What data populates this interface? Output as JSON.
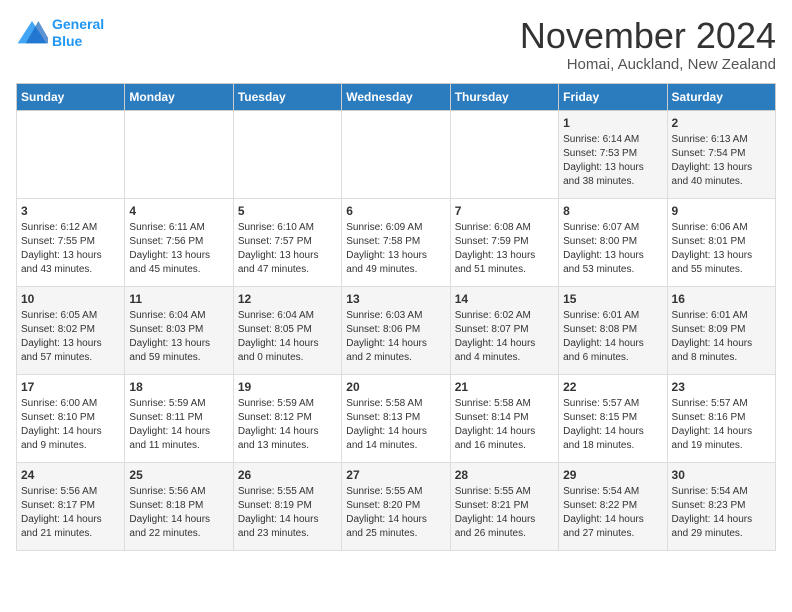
{
  "logo": {
    "line1": "General",
    "line2": "Blue"
  },
  "title": "November 2024",
  "subtitle": "Homai, Auckland, New Zealand",
  "days_of_week": [
    "Sunday",
    "Monday",
    "Tuesday",
    "Wednesday",
    "Thursday",
    "Friday",
    "Saturday"
  ],
  "weeks": [
    [
      {
        "day": "",
        "content": ""
      },
      {
        "day": "",
        "content": ""
      },
      {
        "day": "",
        "content": ""
      },
      {
        "day": "",
        "content": ""
      },
      {
        "day": "",
        "content": ""
      },
      {
        "day": "1",
        "content": "Sunrise: 6:14 AM\nSunset: 7:53 PM\nDaylight: 13 hours\nand 38 minutes."
      },
      {
        "day": "2",
        "content": "Sunrise: 6:13 AM\nSunset: 7:54 PM\nDaylight: 13 hours\nand 40 minutes."
      }
    ],
    [
      {
        "day": "3",
        "content": "Sunrise: 6:12 AM\nSunset: 7:55 PM\nDaylight: 13 hours\nand 43 minutes."
      },
      {
        "day": "4",
        "content": "Sunrise: 6:11 AM\nSunset: 7:56 PM\nDaylight: 13 hours\nand 45 minutes."
      },
      {
        "day": "5",
        "content": "Sunrise: 6:10 AM\nSunset: 7:57 PM\nDaylight: 13 hours\nand 47 minutes."
      },
      {
        "day": "6",
        "content": "Sunrise: 6:09 AM\nSunset: 7:58 PM\nDaylight: 13 hours\nand 49 minutes."
      },
      {
        "day": "7",
        "content": "Sunrise: 6:08 AM\nSunset: 7:59 PM\nDaylight: 13 hours\nand 51 minutes."
      },
      {
        "day": "8",
        "content": "Sunrise: 6:07 AM\nSunset: 8:00 PM\nDaylight: 13 hours\nand 53 minutes."
      },
      {
        "day": "9",
        "content": "Sunrise: 6:06 AM\nSunset: 8:01 PM\nDaylight: 13 hours\nand 55 minutes."
      }
    ],
    [
      {
        "day": "10",
        "content": "Sunrise: 6:05 AM\nSunset: 8:02 PM\nDaylight: 13 hours\nand 57 minutes."
      },
      {
        "day": "11",
        "content": "Sunrise: 6:04 AM\nSunset: 8:03 PM\nDaylight: 13 hours\nand 59 minutes."
      },
      {
        "day": "12",
        "content": "Sunrise: 6:04 AM\nSunset: 8:05 PM\nDaylight: 14 hours\nand 0 minutes."
      },
      {
        "day": "13",
        "content": "Sunrise: 6:03 AM\nSunset: 8:06 PM\nDaylight: 14 hours\nand 2 minutes."
      },
      {
        "day": "14",
        "content": "Sunrise: 6:02 AM\nSunset: 8:07 PM\nDaylight: 14 hours\nand 4 minutes."
      },
      {
        "day": "15",
        "content": "Sunrise: 6:01 AM\nSunset: 8:08 PM\nDaylight: 14 hours\nand 6 minutes."
      },
      {
        "day": "16",
        "content": "Sunrise: 6:01 AM\nSunset: 8:09 PM\nDaylight: 14 hours\nand 8 minutes."
      }
    ],
    [
      {
        "day": "17",
        "content": "Sunrise: 6:00 AM\nSunset: 8:10 PM\nDaylight: 14 hours\nand 9 minutes."
      },
      {
        "day": "18",
        "content": "Sunrise: 5:59 AM\nSunset: 8:11 PM\nDaylight: 14 hours\nand 11 minutes."
      },
      {
        "day": "19",
        "content": "Sunrise: 5:59 AM\nSunset: 8:12 PM\nDaylight: 14 hours\nand 13 minutes."
      },
      {
        "day": "20",
        "content": "Sunrise: 5:58 AM\nSunset: 8:13 PM\nDaylight: 14 hours\nand 14 minutes."
      },
      {
        "day": "21",
        "content": "Sunrise: 5:58 AM\nSunset: 8:14 PM\nDaylight: 14 hours\nand 16 minutes."
      },
      {
        "day": "22",
        "content": "Sunrise: 5:57 AM\nSunset: 8:15 PM\nDaylight: 14 hours\nand 18 minutes."
      },
      {
        "day": "23",
        "content": "Sunrise: 5:57 AM\nSunset: 8:16 PM\nDaylight: 14 hours\nand 19 minutes."
      }
    ],
    [
      {
        "day": "24",
        "content": "Sunrise: 5:56 AM\nSunset: 8:17 PM\nDaylight: 14 hours\nand 21 minutes."
      },
      {
        "day": "25",
        "content": "Sunrise: 5:56 AM\nSunset: 8:18 PM\nDaylight: 14 hours\nand 22 minutes."
      },
      {
        "day": "26",
        "content": "Sunrise: 5:55 AM\nSunset: 8:19 PM\nDaylight: 14 hours\nand 23 minutes."
      },
      {
        "day": "27",
        "content": "Sunrise: 5:55 AM\nSunset: 8:20 PM\nDaylight: 14 hours\nand 25 minutes."
      },
      {
        "day": "28",
        "content": "Sunrise: 5:55 AM\nSunset: 8:21 PM\nDaylight: 14 hours\nand 26 minutes."
      },
      {
        "day": "29",
        "content": "Sunrise: 5:54 AM\nSunset: 8:22 PM\nDaylight: 14 hours\nand 27 minutes."
      },
      {
        "day": "30",
        "content": "Sunrise: 5:54 AM\nSunset: 8:23 PM\nDaylight: 14 hours\nand 29 minutes."
      }
    ]
  ]
}
